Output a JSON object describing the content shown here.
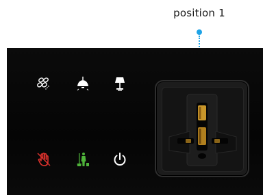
{
  "callout": {
    "label": "position 1",
    "color": "#1ea3e6"
  },
  "panel": {
    "background": "#080808",
    "buttons_row1": [
      {
        "name": "fan-icon",
        "color": "#ffffff"
      },
      {
        "name": "ceiling-lamp-icon",
        "color": "#ffffff"
      },
      {
        "name": "table-lamp-icon",
        "color": "#ffffff"
      }
    ],
    "buttons_row2": [
      {
        "name": "do-not-disturb-hand-icon",
        "color": "#e0322d"
      },
      {
        "name": "make-up-room-icon",
        "color": "#4fb33a"
      },
      {
        "name": "power-icon",
        "color": "#ffffff"
      }
    ]
  },
  "socket": {
    "type": "universal power outlet",
    "accent": "#c8962a"
  }
}
